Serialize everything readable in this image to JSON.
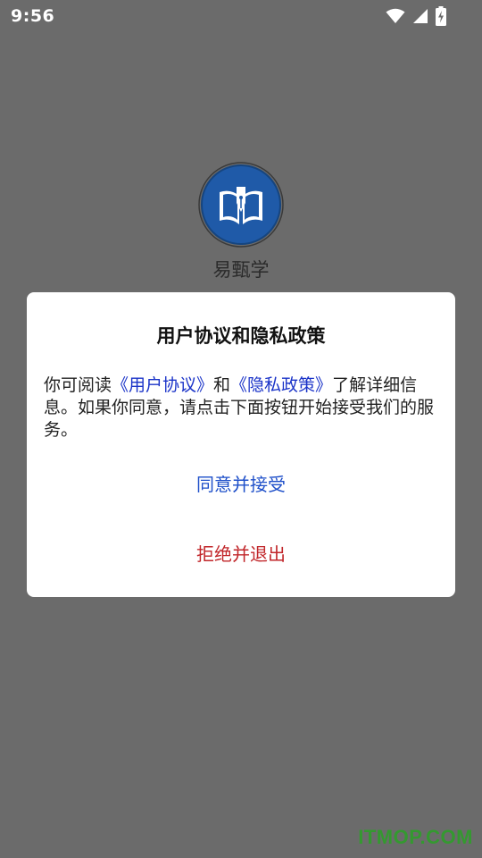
{
  "status_bar": {
    "time": "9:56",
    "icons": [
      "wifi-icon",
      "cell-signal-icon",
      "battery-charging-icon"
    ]
  },
  "app": {
    "name": "易甄学",
    "logo_icon": "open-book-pen-logo",
    "logo_color": "#1f5aa8"
  },
  "dialog": {
    "title": "用户协议和隐私政策",
    "body": {
      "prefix": "你可阅读",
      "user_agreement_link": "《用户协议》",
      "conjunction": "和",
      "privacy_policy_link": "《隐私政策》",
      "suffix": "了解详细信息。如果你同意，请点击下面按钮开始接受我们的服务。"
    },
    "agree_button": "同意并接受",
    "reject_button": "拒绝并退出"
  },
  "watermark": "ITMOP.COM",
  "colors": {
    "overlay": "#6b6b6b",
    "link": "#1a33c8",
    "agree": "#1e4fc9",
    "reject": "#c1262a"
  }
}
